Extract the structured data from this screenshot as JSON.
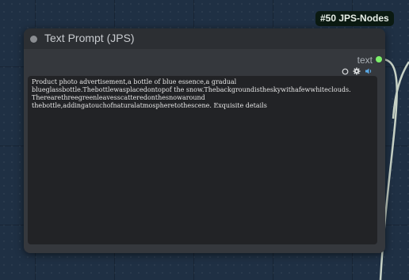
{
  "badge": {
    "label": "#50 JPS-Nodes"
  },
  "node": {
    "title": "Text Prompt (JPS)",
    "output": {
      "label": "text",
      "dot_color": "#7cf06b"
    },
    "icons": [
      "circle-outline-icon",
      "gear-icon",
      "speaker-icon"
    ],
    "text_value": "Product photo advertisement,a bottle of blue essence,a gradual\nblueglassbottle.Thebottlewasplacedontopof the snow.Thebackgroundistheskywithafewwhiteclouds.\nTherearethreegreenleavesscatteredonthesnowaround\nthebottle,addingatouchofnaturalatmospheretothescene. Exquisite details"
  },
  "colors": {
    "canvas": "#1f3044",
    "node_body": "#35383d",
    "node_title": "#2c2f33",
    "wire": "#c7d2c6"
  }
}
